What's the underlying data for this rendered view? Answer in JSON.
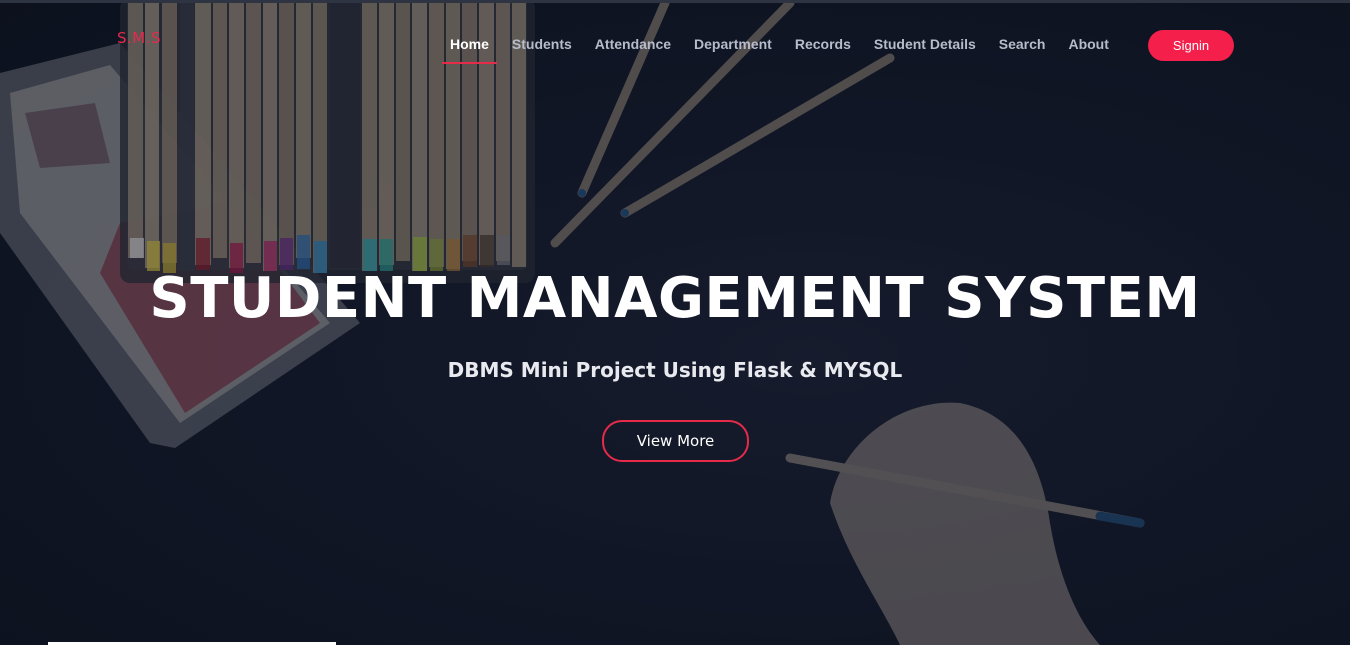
{
  "brand": {
    "logo_text": "S.M.S"
  },
  "nav": {
    "items": [
      {
        "label": "Home",
        "active": true
      },
      {
        "label": "Students"
      },
      {
        "label": "Attendance"
      },
      {
        "label": "Department"
      },
      {
        "label": "Records"
      },
      {
        "label": "Student Details"
      },
      {
        "label": "Search"
      },
      {
        "label": "About"
      }
    ],
    "signin_label": "Signin"
  },
  "hero": {
    "title": "STUDENT MANAGEMENT SYSTEM",
    "subtitle": "DBMS Mini Project Using Flask & MYSQL",
    "cta_label": "View More"
  },
  "colors": {
    "accent": "#f41f4a",
    "logo": "#e52a4a",
    "background": "#0f1424"
  }
}
